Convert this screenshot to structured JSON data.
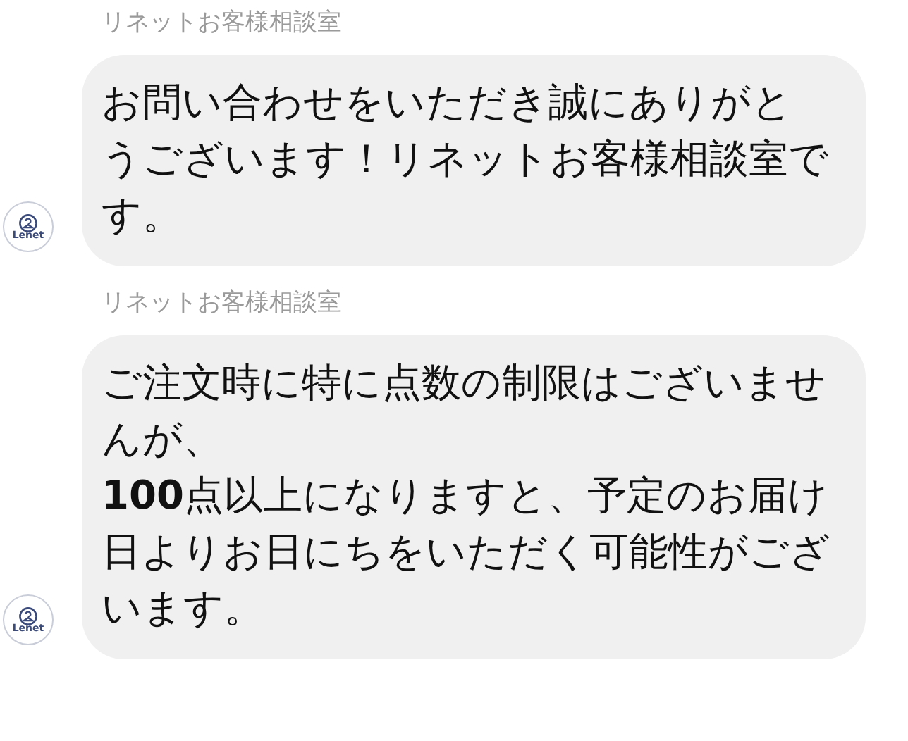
{
  "messages": [
    {
      "sender": "リネットお客様相談室",
      "avatar_label": "Lenet",
      "text": "お問い合わせをいただき誠にありがとうございます！リネットお客様相談室です。"
    },
    {
      "sender": "リネットお客様相談室",
      "avatar_label": "Lenet",
      "text": "ご注文時に特に点数の制限はございませんが、\n**100**点以上になりますと、予定のお届け日よりお日にちをいただく可能性がございます。"
    }
  ]
}
